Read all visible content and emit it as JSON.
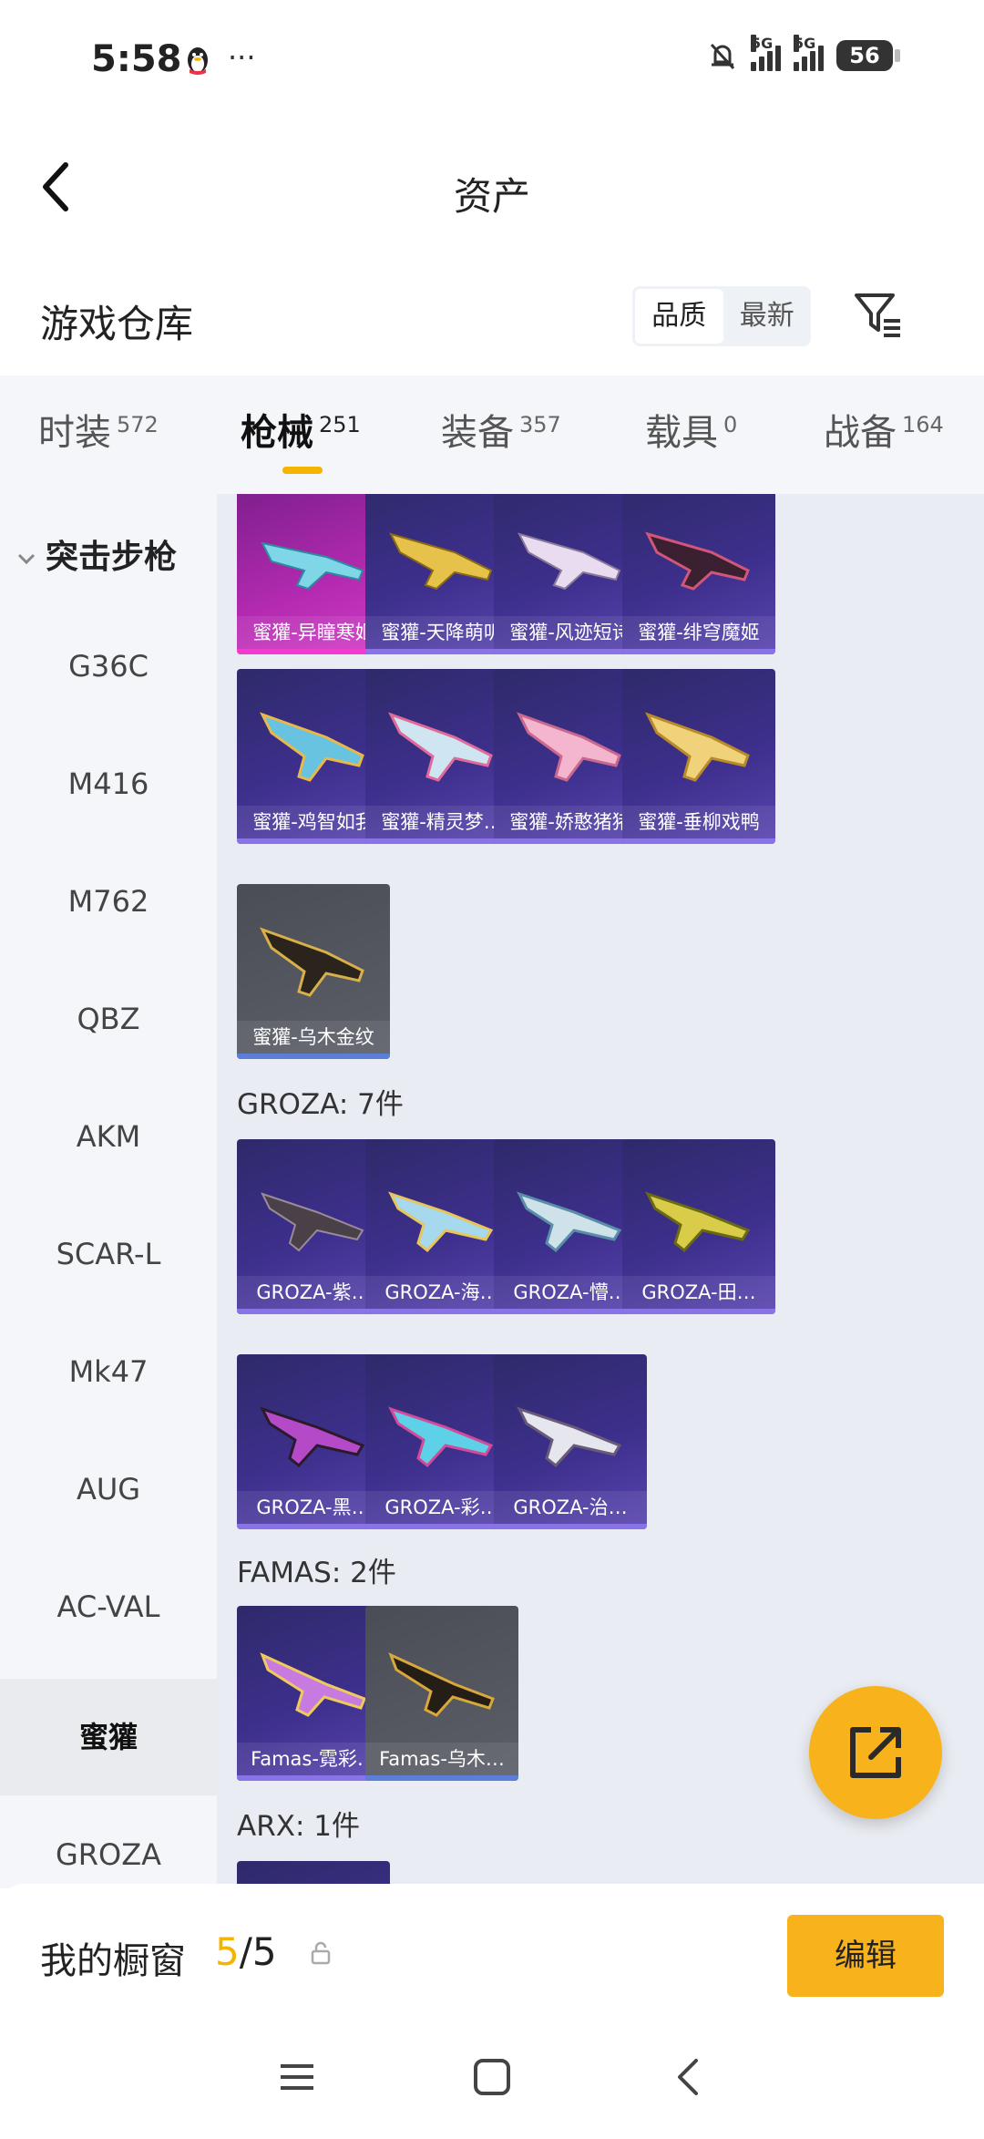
{
  "status_bar": {
    "time": "5:58",
    "battery": "56",
    "signal1": "5G",
    "signal2": "5G"
  },
  "nav": {
    "title": "资产"
  },
  "warehouse": {
    "title": "游戏仓库",
    "sort_quality": "品质",
    "sort_latest": "最新"
  },
  "tabs": [
    {
      "label": "时装",
      "count": "572"
    },
    {
      "label": "枪械",
      "count": "251"
    },
    {
      "label": "装备",
      "count": "357"
    },
    {
      "label": "载具",
      "count": "0"
    },
    {
      "label": "战备",
      "count": "164"
    }
  ],
  "sidebar": {
    "header": "突击步枪",
    "items": [
      "G36C",
      "M416",
      "M762",
      "QBZ",
      "AKM",
      "SCAR-L",
      "Mk47",
      "AUG",
      "AC-VAL",
      "蜜獾",
      "GROZA"
    ],
    "selected": "蜜獾"
  },
  "sections": {
    "groza": "GROZA: 7件",
    "famas": "FAMAS: 2件",
    "arx": "ARX: 1件"
  },
  "cards": {
    "honey": [
      "蜜獾-异瞳寒姬",
      "蜜獾-天降萌叽",
      "蜜獾-风迹短诗",
      "蜜獾-绯穹魔姬",
      "蜜獾-鸡智如我",
      "蜜獾-精灵梦…",
      "蜜獾-娇憨猪猪",
      "蜜獾-垂柳戏鸭",
      "蜜獾-乌木金纹"
    ],
    "groza": [
      "GROZA-紫…",
      "GROZA-海…",
      "GROZA-懵…",
      "GROZA-田…",
      "GROZA-黑…",
      "GROZA-彩…",
      "GROZA-治…"
    ],
    "famas": [
      "Famas-霓彩…",
      "Famas-乌木…"
    ]
  },
  "bottom": {
    "label": "我的橱窗",
    "count_current": "5",
    "count_total": "/5",
    "edit": "编辑"
  },
  "colors": {
    "accent": "#f7b21c",
    "epic_bar": "#8a73e6",
    "legendary_bar": "#f23ccf",
    "common_bar": "#5b7fd9"
  }
}
